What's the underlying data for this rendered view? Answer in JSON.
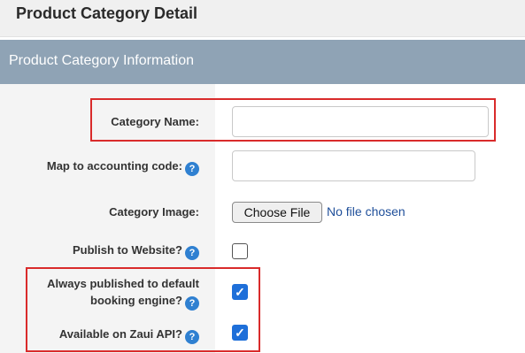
{
  "page": {
    "title": "Product Category Detail"
  },
  "section": {
    "title": "Product Category Information"
  },
  "fields": {
    "category_name": {
      "label": "Category Name:",
      "value": ""
    },
    "accounting_code": {
      "label": "Map to accounting code:",
      "value": ""
    },
    "category_image": {
      "label": "Category Image:",
      "button_label": "Choose File",
      "status": "No file chosen"
    },
    "publish_website": {
      "label": "Publish to Website?",
      "checked": false
    },
    "default_booking": {
      "label_line1": "Always published to default",
      "label_line2": "booking engine?",
      "checked": true
    },
    "zaui_api": {
      "label": "Available on Zaui API?",
      "checked": true
    }
  },
  "icons": {
    "help": "question-circle-icon",
    "check": "checkmark-icon"
  },
  "colors": {
    "section_bar": "#8fa3b5",
    "help_icon": "#2f80d1",
    "checkbox_checked": "#1e6fd9",
    "highlight": "#d92b2b"
  }
}
